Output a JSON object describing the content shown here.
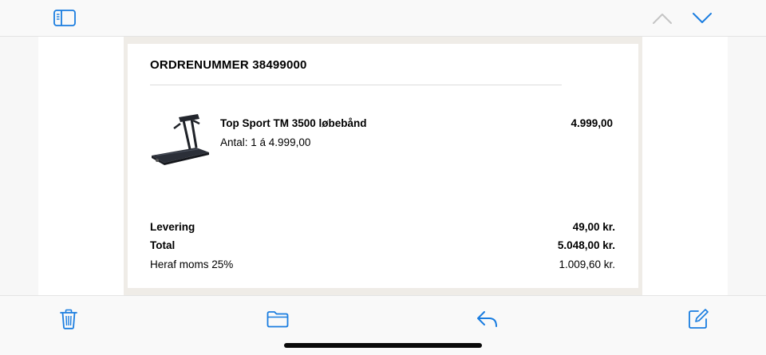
{
  "colors": {
    "accent": "#1a7de0",
    "disabled": "#c5c5c5",
    "frame": "#efece7"
  },
  "toolbar": {
    "sidebar_icon": "sidebar-toggle-icon",
    "prev_icon": "chevron-up-icon",
    "next_icon": "chevron-down-icon"
  },
  "order": {
    "title": "ORDRENUMMER 38499000",
    "item": {
      "name": "Top Sport TM 3500 løbebånd",
      "quantity": "Antal: 1 á 4.999,00",
      "price": "4.999,00",
      "image_icon": "treadmill-image"
    },
    "summary": {
      "delivery_label": "Levering",
      "delivery_value": "49,00 kr.",
      "total_label": "Total",
      "total_value": "5.048,00 kr.",
      "vat_label": "Heraf moms 25%",
      "vat_value": "1.009,60 kr."
    }
  },
  "bottom_toolbar": {
    "trash_icon": "trash-icon",
    "folder_icon": "folder-icon",
    "reply_icon": "reply-icon",
    "compose_icon": "compose-icon"
  }
}
